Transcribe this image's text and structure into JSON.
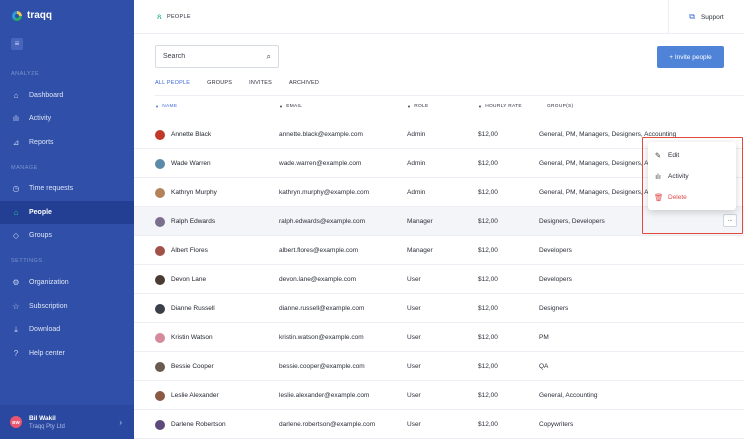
{
  "app": {
    "name": "traqq"
  },
  "sidebar": {
    "sections": [
      {
        "label": "ANALYZE",
        "items": [
          {
            "label": "Dashboard",
            "icon": "home-icon"
          },
          {
            "label": "Activity",
            "icon": "bar-chart-icon"
          },
          {
            "label": "Reports",
            "icon": "reports-icon"
          }
        ]
      },
      {
        "label": "MANAGE",
        "items": [
          {
            "label": "Time requests",
            "icon": "clock-icon"
          },
          {
            "label": "People",
            "icon": "people-icon",
            "active": true
          },
          {
            "label": "Groups",
            "icon": "layers-icon"
          }
        ]
      },
      {
        "label": "SETTINGS",
        "items": [
          {
            "label": "Organization",
            "icon": "gear-icon"
          },
          {
            "label": "Subscription",
            "icon": "star-icon"
          },
          {
            "label": "Download",
            "icon": "download-icon"
          },
          {
            "label": "Help center",
            "icon": "help-icon"
          }
        ]
      }
    ],
    "user": {
      "initials": "BW",
      "name": "Bil Wakil",
      "org": "Traqq Pty Ltd"
    }
  },
  "topbar": {
    "breadcrumb": "PEOPLE",
    "support_label": "Support"
  },
  "toolbar": {
    "search_placeholder": "Search",
    "invite_label": "+ Invite people"
  },
  "tabs": [
    {
      "label": "ALL PEOPLE",
      "active": true
    },
    {
      "label": "GROUPS"
    },
    {
      "label": "INVITES"
    },
    {
      "label": "ARCHIVED"
    }
  ],
  "table": {
    "headers": {
      "name": "NAME",
      "email": "EMAIL",
      "role": "ROLE",
      "rate": "HOURLY RATE",
      "groups": "GROUP(S)"
    },
    "rows": [
      {
        "name": "Annette Black",
        "email": "annette.black@example.com",
        "role": "Admin",
        "rate": "$12,00",
        "groups": "General, PM, Managers, Designers, Accounting",
        "avatar_color": "#c0392b"
      },
      {
        "name": "Wade Warren",
        "email": "wade.warren@example.com",
        "role": "Admin",
        "rate": "$12,00",
        "groups": "General, PM, Managers, Designers, Accounting",
        "avatar_color": "#5d8aa8"
      },
      {
        "name": "Kathryn Murphy",
        "email": "kathryn.murphy@example.com",
        "role": "Admin",
        "rate": "$12,00",
        "groups": "General, PM, Managers, Designers, Accounting",
        "avatar_color": "#b5835a"
      },
      {
        "name": "Ralph Edwards",
        "email": "ralph.edwards@example.com",
        "role": "Manager",
        "rate": "$12,00",
        "groups": "Designers, Developers",
        "avatar_color": "#7a6f8c",
        "hover": true
      },
      {
        "name": "Albert Flores",
        "email": "albert.flores@example.com",
        "role": "Manager",
        "rate": "$12,00",
        "groups": "Developers",
        "avatar_color": "#a0524a"
      },
      {
        "name": "Devon Lane",
        "email": "devon.lane@example.com",
        "role": "User",
        "rate": "$12,00",
        "groups": "Developers",
        "avatar_color": "#4a3b35"
      },
      {
        "name": "Dianne Russell",
        "email": "dianne.russell@example.com",
        "role": "User",
        "rate": "$12,00",
        "groups": "Designers",
        "avatar_color": "#3b3f4a"
      },
      {
        "name": "Kristin Watson",
        "email": "kristin.watson@example.com",
        "role": "User",
        "rate": "$12,00",
        "groups": "PM",
        "avatar_color": "#d48a9a"
      },
      {
        "name": "Bessie Cooper",
        "email": "bessie.cooper@example.com",
        "role": "User",
        "rate": "$12,00",
        "groups": "QA",
        "avatar_color": "#6b5a4e"
      },
      {
        "name": "Leslie Alexander",
        "email": "leslie.alexander@example.com",
        "role": "User",
        "rate": "$12,00",
        "groups": "General, Accounting",
        "avatar_color": "#8a5a44"
      },
      {
        "name": "Darlene Robertson",
        "email": "darlene.robertson@example.com",
        "role": "User",
        "rate": "$12,00",
        "groups": "Copywriters",
        "avatar_color": "#5b4a7a"
      }
    ],
    "row_actions_label": "···"
  },
  "context_menu": {
    "items": [
      {
        "label": "Edit",
        "icon": "edit-user-icon"
      },
      {
        "label": "Activity",
        "icon": "bar-chart-icon"
      },
      {
        "label": "Delete",
        "icon": "trash-icon",
        "danger": true
      }
    ]
  },
  "colors": {
    "sidebar": "#2f4fa8",
    "accent": "#3d68d8",
    "button": "#4f83d8",
    "danger": "#e34b4b",
    "highlight": "#e24b3b"
  }
}
